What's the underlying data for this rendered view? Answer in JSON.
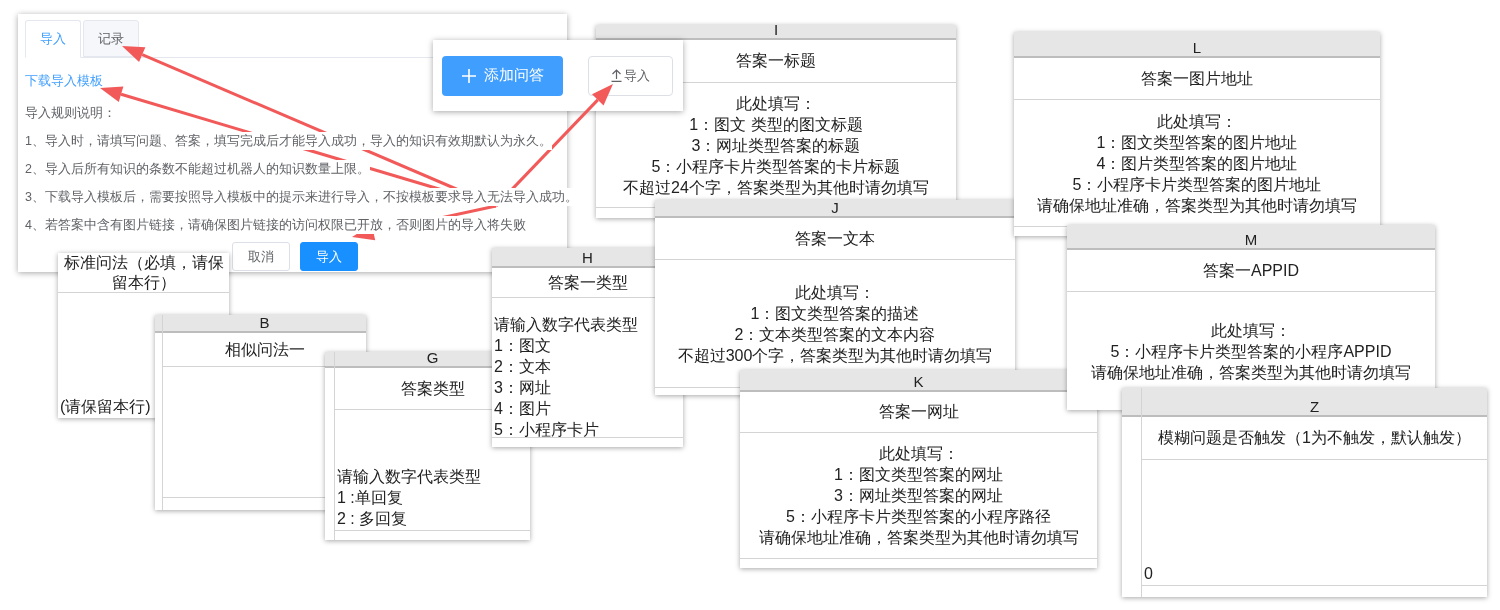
{
  "dialog": {
    "tabs": [
      {
        "label": "导入",
        "selected": true
      },
      {
        "label": "记录",
        "selected": false
      }
    ],
    "template_link": "下载导入模板",
    "rules_heading": "导入规则说明：",
    "rules": [
      "1、导入时，请填写问题、答案，填写完成后才能导入成功，导入的知识有效期默认为永久。",
      "2、导入后所有知识的条数不能超过机器人的知识数量上限。",
      "3、下载导入模板后，需要按照导入模板中的提示来进行导入，不按模板要求导入无法导入成功。",
      "4、若答案中含有图片链接，请确保图片链接的访问权限已开放，否则图片的导入将失败"
    ],
    "buttons": [
      {
        "label": "取消",
        "kind": "default"
      },
      {
        "label": "导入",
        "kind": "primary"
      }
    ]
  },
  "toolbar": {
    "buttons": [
      {
        "label": "添加问答",
        "kind": "add"
      },
      {
        "label": "导入",
        "kind": "upload"
      }
    ]
  },
  "sheet_columns": [
    {
      "title": "标准问法（必填，请保留本行）",
      "lines": [
        "(请保留本行)"
      ]
    },
    {
      "column": "B",
      "title": "相似问法一"
    },
    {
      "column": "G",
      "title": "答案类型",
      "lines": [
        "请输入数字代表类型",
        "1 :单回复",
        "2 : 多回复"
      ]
    },
    {
      "column": "H",
      "title": "答案一类型",
      "lines": [
        "请输入数字代表类型",
        "1：图文",
        "2：文本",
        "3：网址",
        "4：图片",
        "5：小程序卡片"
      ]
    },
    {
      "column": "I",
      "title": "答案一标题",
      "lines": [
        "此处填写：",
        "1：图文 类型的图文标题",
        "3：网址类型答案的标题",
        "5：小程序卡片类型答案的卡片标题",
        "不超过24个字，答案类型为其他时请勿填写"
      ]
    },
    {
      "column": "J",
      "title": "答案一文本",
      "lines": [
        "此处填写：",
        "1：图文类型答案的描述",
        "2：文本类型答案的文本内容",
        "不超过300个字，答案类型为其他时请勿填写"
      ]
    },
    {
      "column": "K",
      "title": "答案一网址",
      "lines": [
        "此处填写：",
        "1：图文类型答案的网址",
        "3：网址类型答案的网址",
        "5：小程序卡片类型答案的小程序路径",
        "请确保地址准确，答案类型为其他时请勿填写"
      ]
    },
    {
      "column": "L",
      "title": "答案一图片地址",
      "lines": [
        "此处填写：",
        "1：图文类型答案的图片地址",
        "4：图片类型答案的图片地址",
        "5：小程序卡片类型答案的图片地址",
        "请确保地址准确，答案类型为其他时请勿填写"
      ]
    },
    {
      "column": "M",
      "title": "答案一APPID",
      "lines": [
        "此处填写：",
        "5：小程序卡片类型答案的小程序APPID",
        "请确保地址准确，答案类型为其他时请勿填写"
      ]
    },
    {
      "column": "Z",
      "title": "模糊问题是否触发（1为不触发，默认触发）",
      "lines": [
        "0"
      ]
    }
  ]
}
